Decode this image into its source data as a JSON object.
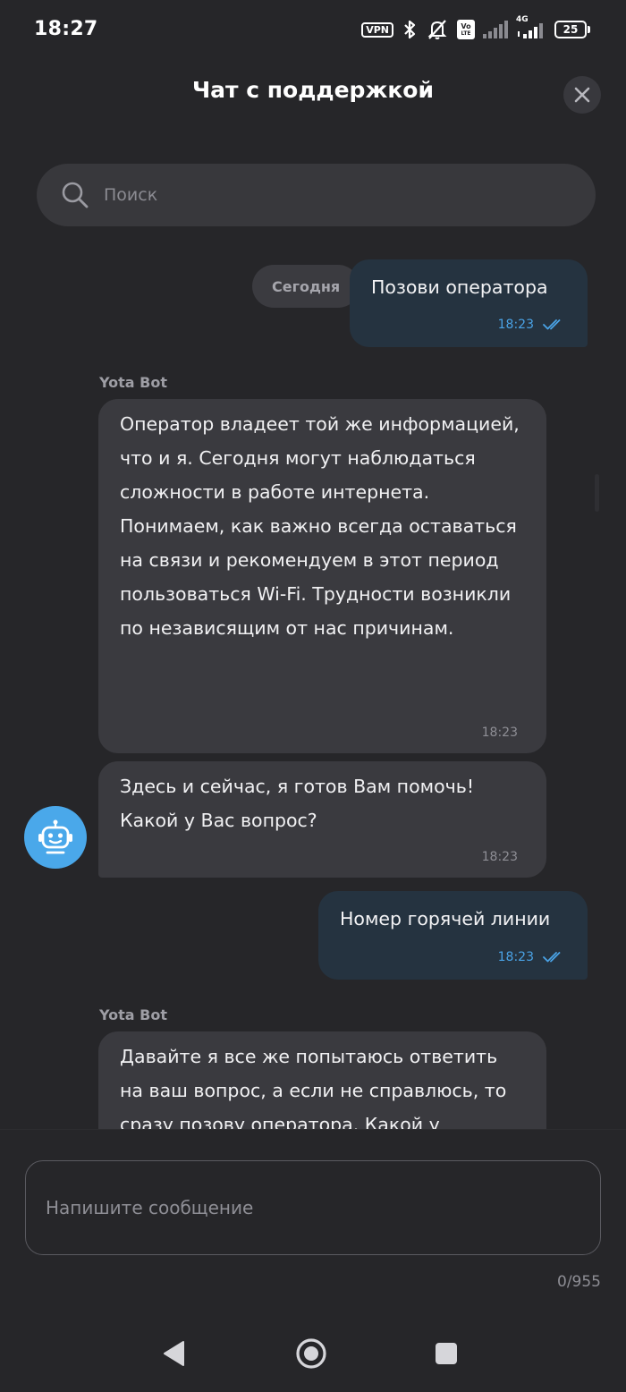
{
  "status_bar": {
    "time": "18:27",
    "vpn_label": "VPN",
    "volte_label_top": "Vo",
    "volte_label_bottom": "LTE",
    "network_label": "4G",
    "battery_level": "25"
  },
  "header": {
    "title": "Чат с поддержкой"
  },
  "search": {
    "placeholder": "Поиск"
  },
  "chat": {
    "date_chip": "Сегодня",
    "messages": [
      {
        "direction": "outgoing",
        "text": "Позови оператора",
        "time": "18:23",
        "status": "read"
      },
      {
        "direction": "incoming",
        "sender": "Yota Bot",
        "text": "Оператор владеет той же информацией, что и я. Сегодня могут наблюдаться сложности в работе интернета. Понимаем, как важно всегда оставаться на связи и рекомендуем в этот период пользоваться Wi-Fi. Трудности возникли по независящим от нас причинам.",
        "time": "18:23"
      },
      {
        "direction": "incoming",
        "text": "Здесь и сейчас, я готов Вам помочь! Какой у Вас вопрос?",
        "time": "18:23"
      },
      {
        "direction": "outgoing",
        "text": "Номер горячей линии",
        "time": "18:23",
        "status": "read"
      },
      {
        "direction": "incoming",
        "sender": "Yota Bot",
        "text": "Давайте я все же попытаюсь ответить на ваш вопрос, а если не справлюсь, то сразу позову оператора. Какой у"
      }
    ]
  },
  "composer": {
    "placeholder": "Напишите сообщение",
    "counter": "0/955"
  },
  "icons": {
    "search": "search-icon",
    "close": "close-icon",
    "read_receipt": "double-check-icon",
    "bot": "robot-icon",
    "back": "back-triangle-icon",
    "home": "home-circle-icon",
    "recents": "recents-square-icon"
  },
  "colors": {
    "background": "#262629",
    "incoming_bubble": "#3a3a3f",
    "outgoing_bubble": "#253340",
    "accent": "#4aa3e6",
    "bot_avatar": "#4aa8ea"
  }
}
